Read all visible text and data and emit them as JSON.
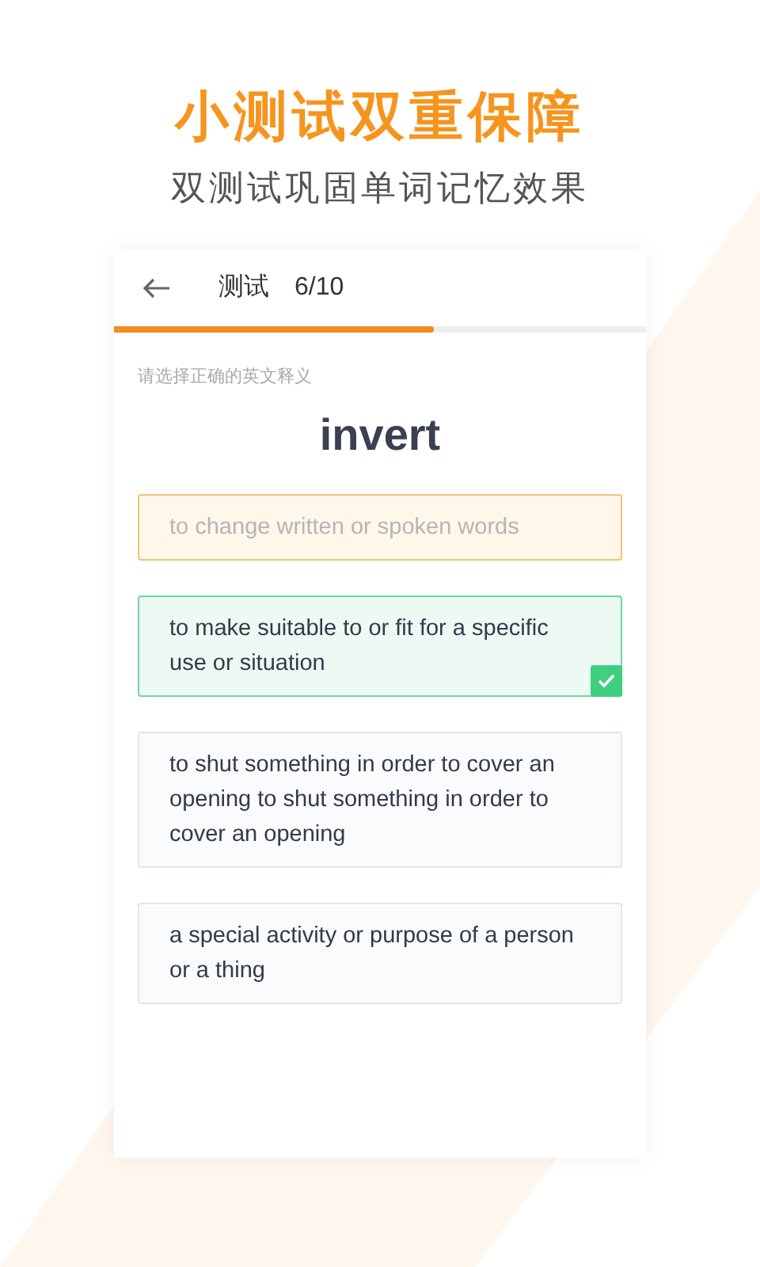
{
  "headline": "小测试双重保障",
  "subheadline": "双测试巩固单词记忆效果",
  "quiz": {
    "title": "测试",
    "counter": "6/10",
    "progress": {
      "level": 0.6
    },
    "prompt": "请选择正确的英文释义",
    "word": "invert",
    "options": [
      {
        "text": "to change written or spoken words",
        "kind": "wrong"
      },
      {
        "text": "to make suitable to or fit for a specific use or situation",
        "kind": "correct"
      },
      {
        "text": "to shut something in order to cover an opening to shut something in order to cover an opening",
        "kind": "normal"
      },
      {
        "text": "a special activity or purpose of a person or a thing",
        "kind": "normal"
      }
    ]
  }
}
